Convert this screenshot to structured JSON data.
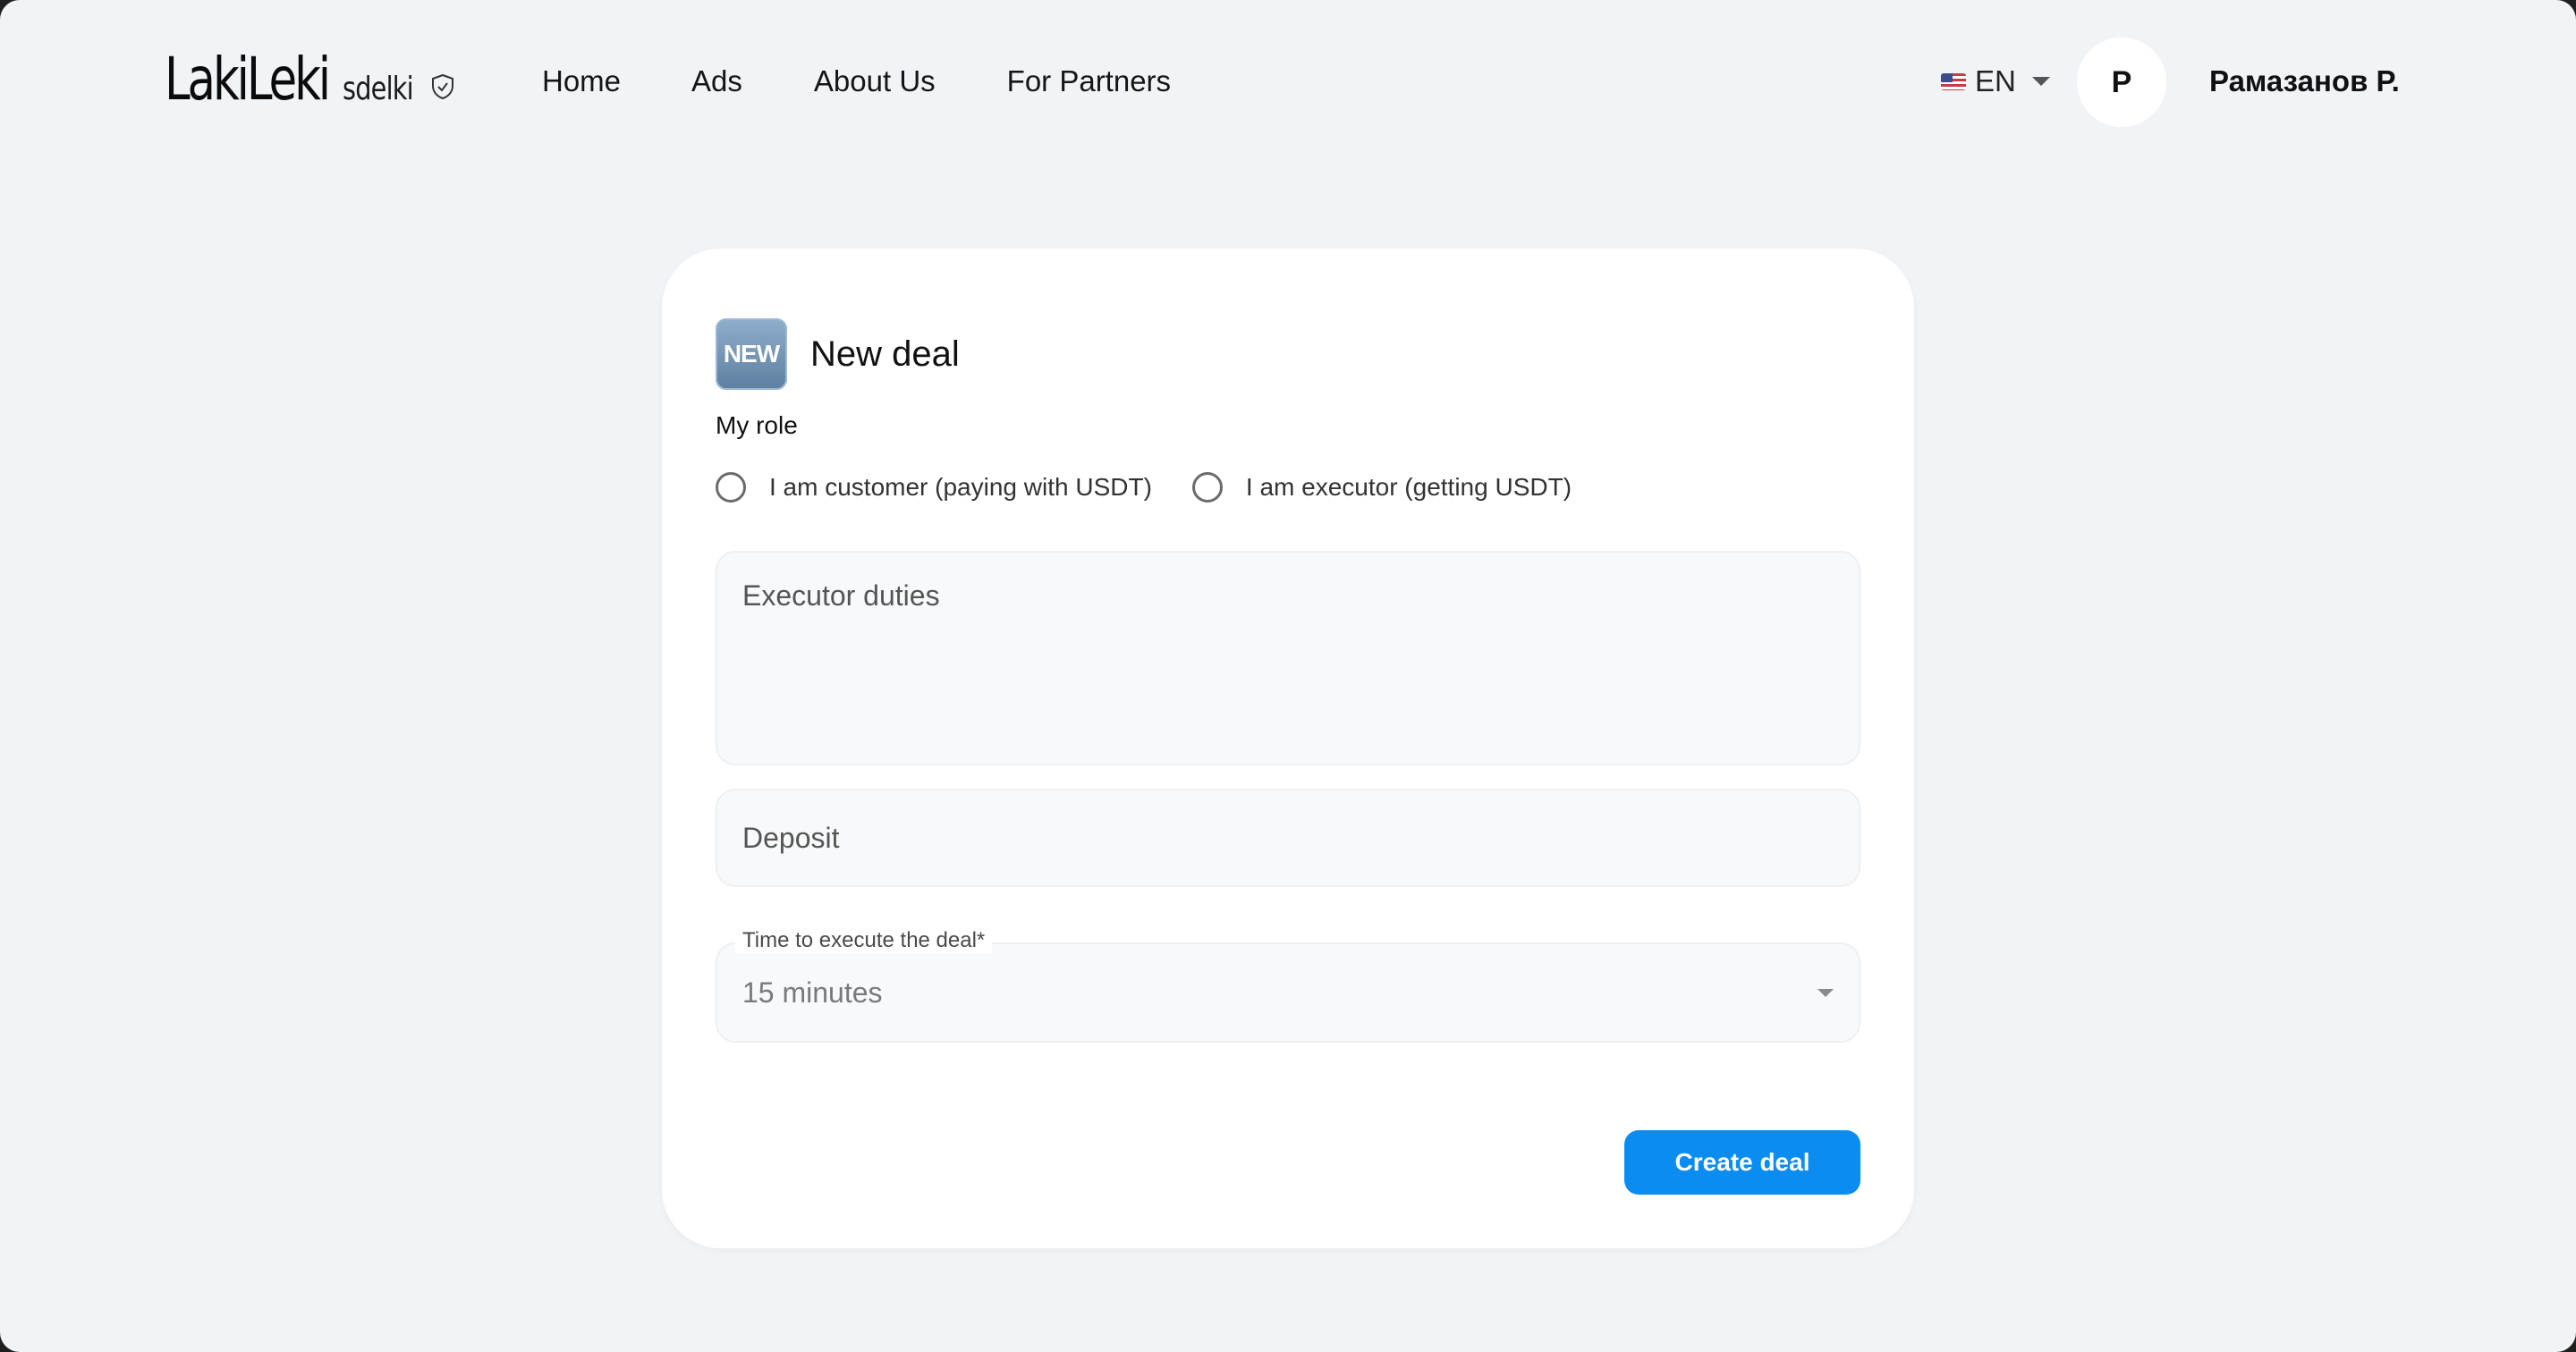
{
  "brand": {
    "logo_main": "LakiLeki",
    "logo_sub": "sdelki"
  },
  "nav": {
    "items": [
      "Home",
      "Ads",
      "About Us",
      "For Partners"
    ]
  },
  "header": {
    "language": "EN",
    "avatar_initial": "P",
    "user_name": "Рамазанов Р."
  },
  "form": {
    "badge": "NEW",
    "title": "New deal",
    "role_label": "My role",
    "roles": [
      "I am customer (paying with USDT)",
      "I am executor (getting USDT)"
    ],
    "duties_placeholder": "Executor duties",
    "deposit_placeholder": "Deposit",
    "time_label": "Time to execute the deal*",
    "time_value": "15 minutes",
    "submit_label": "Create deal"
  },
  "colors": {
    "page_background": "#f1f4f7",
    "card_background": "#ffffff",
    "accent_button": "#0a8cf0",
    "field_background": "#f7f9fb"
  },
  "icons": {
    "logo_badge": "shield-check-icon",
    "language_flag": "us-flag-icon",
    "dropdown": "chevron-down-icon"
  }
}
